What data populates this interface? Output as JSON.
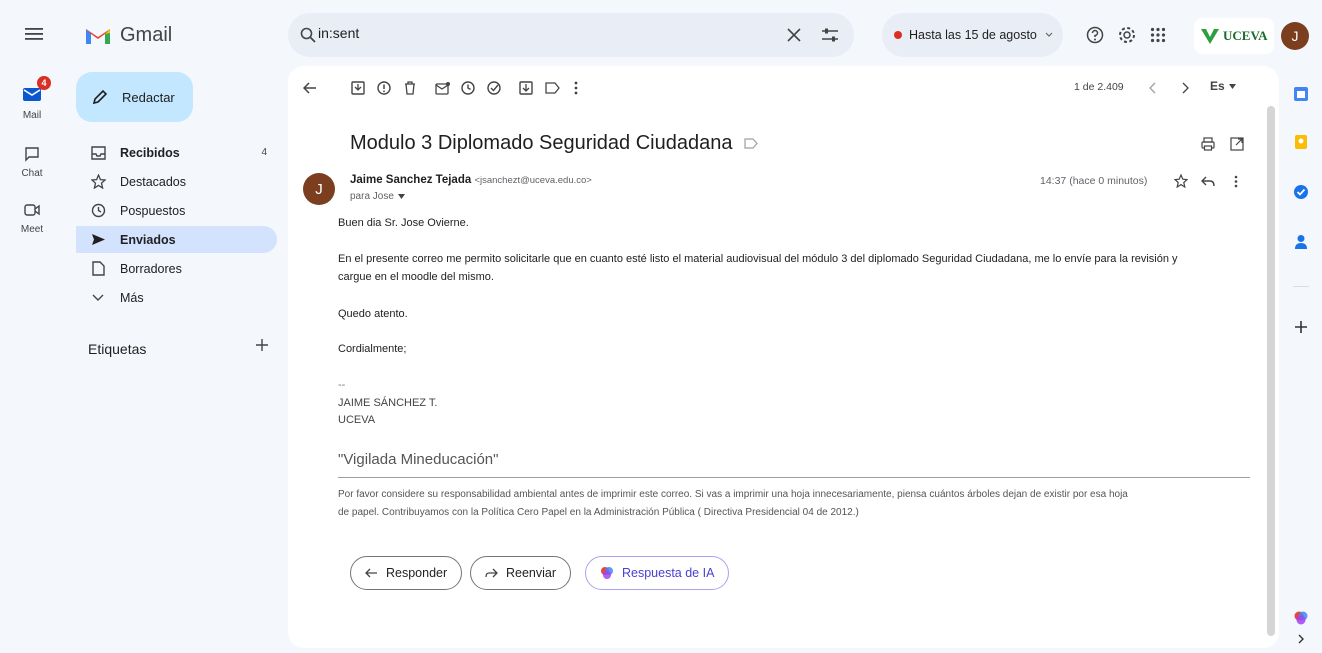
{
  "app": {
    "name": "Gmail"
  },
  "rail": {
    "mail_label": "Mail",
    "mail_badge": "4",
    "chat_label": "Chat",
    "meet_label": "Meet"
  },
  "sidebar": {
    "compose_label": "Redactar",
    "items": [
      {
        "label": "Recibidos",
        "count": "4"
      },
      {
        "label": "Destacados"
      },
      {
        "label": "Pospuestos"
      },
      {
        "label": "Enviados"
      },
      {
        "label": "Borradores"
      },
      {
        "label": "Más"
      }
    ],
    "labels_title": "Etiquetas"
  },
  "search": {
    "value": "in:sent"
  },
  "status": {
    "label": "Hasta las 15 de agosto"
  },
  "account": {
    "org_logo_text": "UCEVA",
    "avatar_letter": "J"
  },
  "toolbar": {
    "pagination": "1 de 2.409",
    "language": "Es"
  },
  "email": {
    "subject": "Modulo 3 Diplomado Seguridad Ciudadana",
    "sender_name": "Jaime Sanchez Tejada",
    "sender_email": "<jsanchezt@uceva.edu.co>",
    "recipient": "para Jose",
    "time": "14:37 (hace 0 minutos)",
    "avatar_letter": "J",
    "greeting": "Buen dia Sr. Jose Ovierne.",
    "paragraph_1": "En el presente correo me permito solicitarle que en cuanto esté listo el material audiovisual del módulo 3 del diplomado Seguridad Ciudadana, me lo envíe para la revisión y",
    "paragraph_1b": "cargue en el moodle del mismo.",
    "closing_1": "Quedo atento.",
    "closing_2": "Cordialmente;",
    "sig_sep": "--",
    "sig_name": "JAIME SÁNCHEZ T.",
    "sig_org": "UCEVA",
    "vigilada": "\"Vigilada Mineducación\"",
    "footer_1": "Por favor considere su responsabilidad ambiental antes de imprimir este correo.  Si vas a imprimir una hoja innecesariamente, piensa cuántos árboles dejan de existir por esa hoja",
    "footer_2": "de papel.   Contribuyamos con la Política Cero Papel en la Administración Pública ( Directiva Presidencial 04 de 2012.)"
  },
  "actions": {
    "reply": "Responder",
    "forward": "Reenviar",
    "ai_reply": "Respuesta de IA"
  }
}
